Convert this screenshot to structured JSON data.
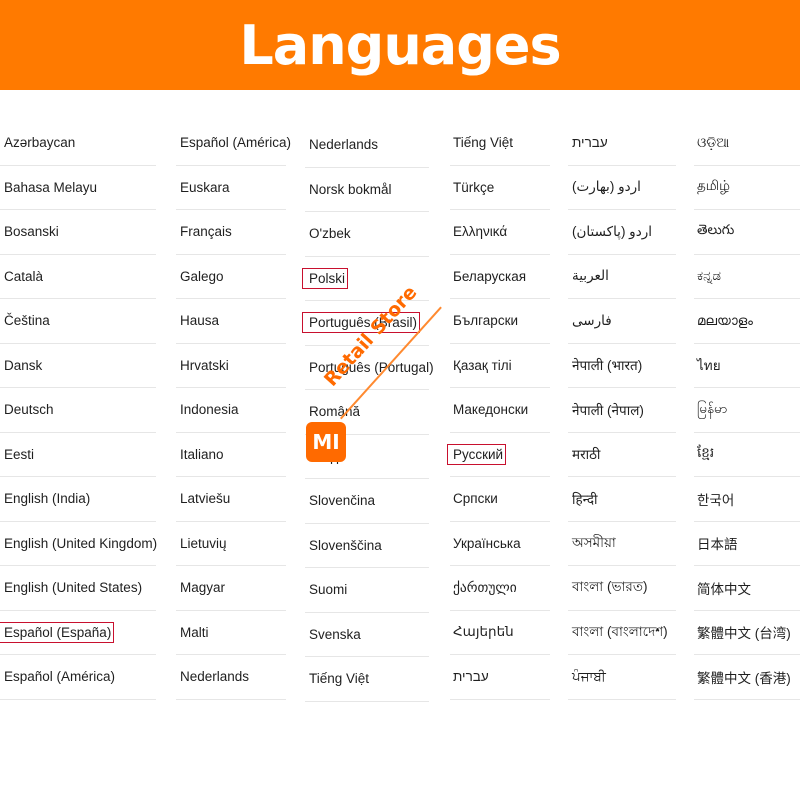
{
  "banner": {
    "title": "Languages"
  },
  "watermark": {
    "logo": "MI",
    "text": "Retail Store"
  },
  "columns": [
    {
      "items": [
        "Azərbaycan",
        "Bahasa Melayu",
        "Bosanski",
        "Català",
        "Čeština",
        "Dansk",
        "Deutsch",
        "Eesti",
        "English (India)",
        "English (United Kingdom)",
        "English (United States)",
        "Español (España)",
        "Español (América)"
      ]
    },
    {
      "items": [
        "Español (América)",
        "Euskara",
        "Français",
        "Galego",
        "Hausa",
        "Hrvatski",
        "Indonesia",
        "Italiano",
        "Latviešu",
        "Lietuvių",
        "Magyar",
        "Malti",
        "Nederlands"
      ]
    },
    {
      "items": [
        "Nederlands",
        "Norsk bokmål",
        "O'zbek",
        "Polski",
        "Português (Brasil)",
        "Português (Portugal)",
        "Română",
        "Shqip",
        "Slovenčina",
        "Slovenščina",
        "Suomi",
        "Svenska",
        "Tiếng Việt"
      ]
    },
    {
      "items": [
        "Tiếng Việt",
        "Türkçe",
        "Ελληνικά",
        "Беларуская",
        "Български",
        "Қазақ тілі",
        "Македонски",
        "Русский",
        "Српски",
        "Українська",
        "ქართული",
        "Հայերեն",
        "עברית"
      ]
    },
    {
      "items": [
        "עברית",
        "اردو (بھارت)",
        "اردو (پاکستان)",
        "العربية",
        "فارسی",
        "नेपाली (भारत)",
        "नेपाली (नेपाल)",
        "मराठी",
        "हिन्दी",
        "অসমীয়া",
        "বাংলা (ভারত)",
        "বাংলা (বাংলাদেশ)",
        "ਪੰਜਾਬੀ"
      ]
    },
    {
      "items": [
        "ଓଡ଼ିଆ",
        "தமிழ்",
        "తెలుగు",
        "ಕನ್ನಡ",
        "മലയാളം",
        "ไทย",
        "မြန်မာ",
        "ខ្មែរ",
        "한국어",
        "日本語",
        "简体中文",
        "繁體中文 (台湾)",
        "繁體中文 (香港)"
      ]
    }
  ]
}
